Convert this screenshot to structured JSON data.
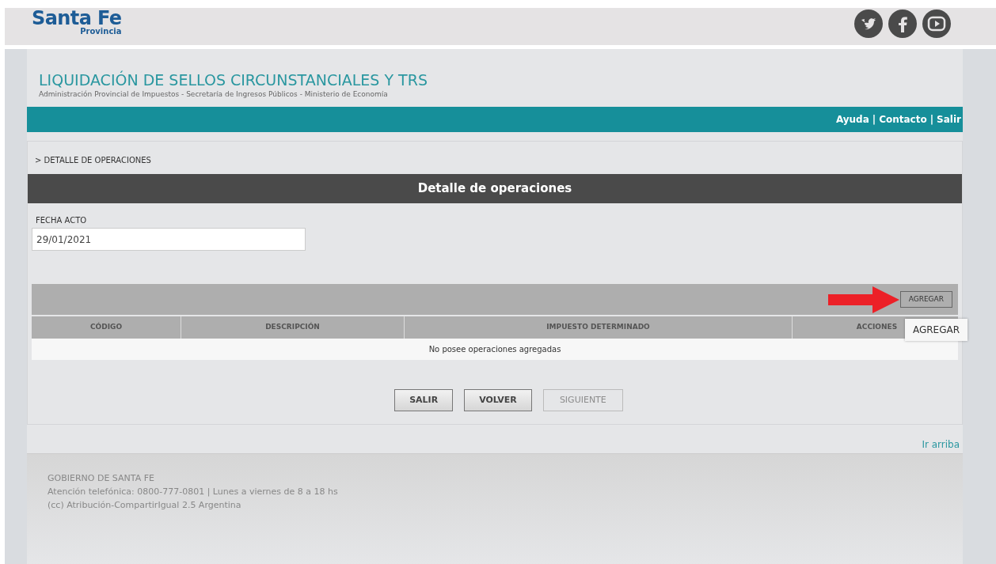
{
  "logo": {
    "name": "Santa Fe",
    "subtitle": "Provincia"
  },
  "header": {
    "title": "LIQUIDACIÓN DE SELLOS CIRCUNSTANCIALES Y TRS",
    "subtitle": "Administración Provincial de Impuestos - Secretaría de Ingresos Públicos - Ministerio de Economía"
  },
  "nav": {
    "separator": "|",
    "links": [
      "Ayuda",
      "Contacto",
      "Salir"
    ]
  },
  "breadcrumb": "> DETALLE DE OPERACIONES",
  "section_title": "Detalle de operaciones",
  "field": {
    "label": "FECHA ACTO",
    "value": "29/01/2021"
  },
  "table": {
    "add_button": "AGREGAR",
    "tooltip": "AGREGAR",
    "columns": [
      "CÓDIGO",
      "DESCRIPCIÓN",
      "IMPUESTO DETERMINADO",
      "ACCIONES"
    ],
    "empty_message": "No posee operaciones agregadas"
  },
  "buttons": [
    {
      "label": "SALIR",
      "disabled": false
    },
    {
      "label": "VOLVER",
      "disabled": false
    },
    {
      "label": "SIGUIENTE",
      "disabled": true
    }
  ],
  "top_link": "Ir arriba",
  "footer": [
    "GOBIERNO DE SANTA FE",
    "Atención telefónica: 0800-777-0801 | Lunes a viernes de 8 a 18 hs",
    "(cc) Atribución-CompartirIgual 2.5 Argentina"
  ]
}
